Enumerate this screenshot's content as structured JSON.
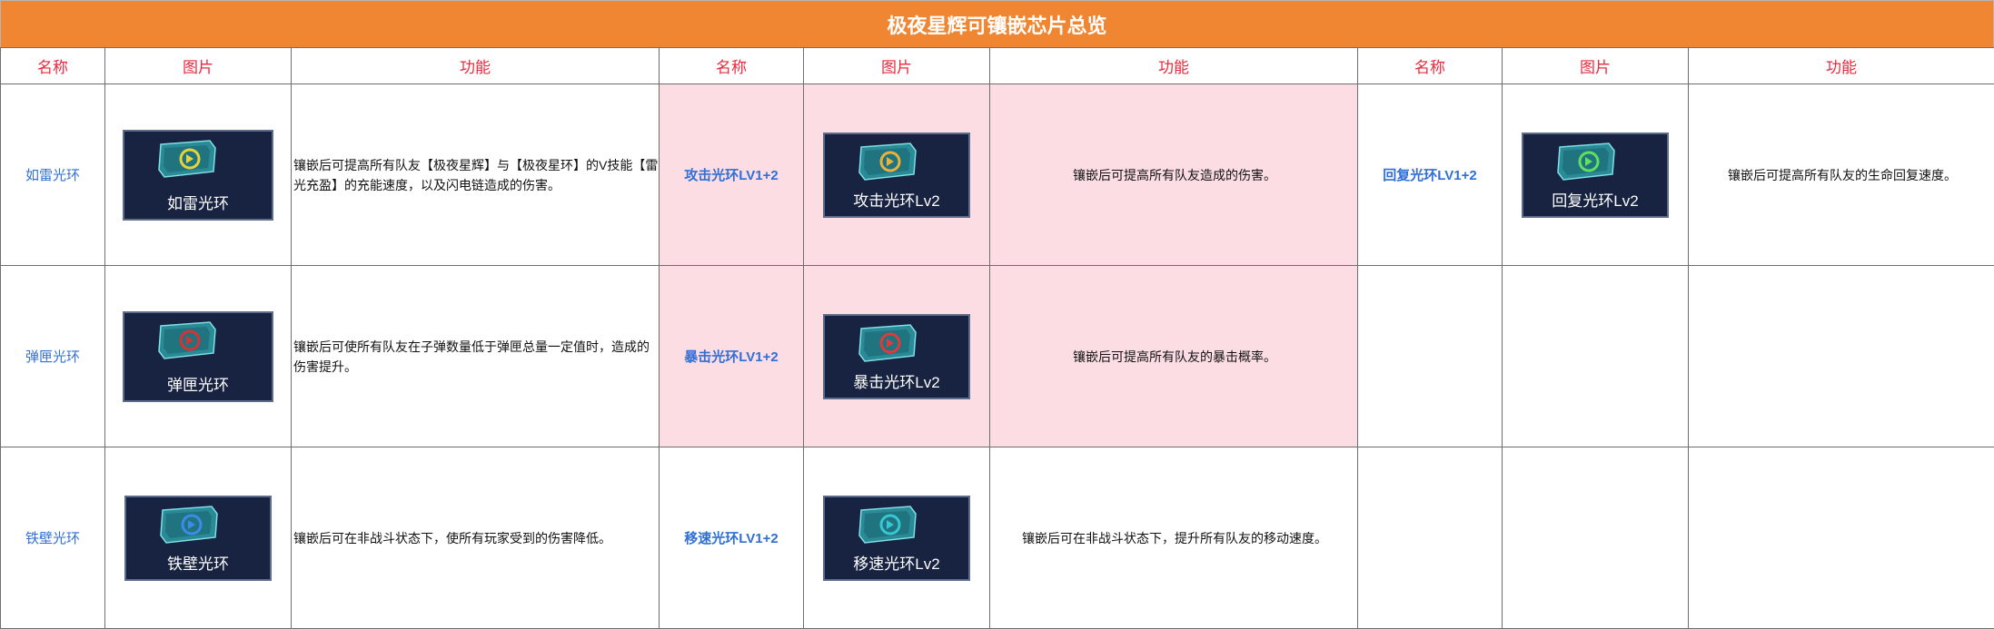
{
  "title": "极夜星辉可镶嵌芯片总览",
  "headers": [
    "名称",
    "图片",
    "功能",
    "名称",
    "图片",
    "功能",
    "名称",
    "图片",
    "功能"
  ],
  "colors": {
    "title_bg": "#f08632",
    "header_text": "#e8293d",
    "name_text": "#2f6fd6",
    "highlight_bg": "#fbdde3",
    "chip_bg": "#172341"
  },
  "rows": [
    [
      {
        "name": "如雷光环",
        "image_label": "如雷光环",
        "icon": "lightning-chip-icon",
        "icon_color": "#e8d23c",
        "function": "镶嵌后可提高所有队友【极夜星辉】与【极夜星环】的V技能【雷光充盈】的充能速度，以及闪电链造成的伤害。"
      },
      {
        "name": "攻击光环LV1+2",
        "image_label": "攻击光环Lv2",
        "icon": "attack-chip-icon",
        "icon_color": "#e8b23c",
        "function": "镶嵌后可提高所有队友造成的伤害。"
      },
      {
        "name": "回复光环LV1+2",
        "image_label": "回复光环Lv2",
        "icon": "heal-chip-icon",
        "icon_color": "#5fe05f",
        "function": "镶嵌后可提高所有队友的生命回复速度。"
      }
    ],
    [
      {
        "name": "弹匣光环",
        "image_label": "弹匣光环",
        "icon": "magazine-chip-icon",
        "icon_color": "#d83232",
        "function": "镶嵌后可使所有队友在子弹数量低于弹匣总量一定值时，造成的伤害提升。"
      },
      {
        "name": "暴击光环LV1+2",
        "image_label": "暴击光环Lv2",
        "icon": "critical-chip-icon",
        "icon_color": "#e03a3a",
        "function": "镶嵌后可提高所有队友的暴击概率。"
      },
      null
    ],
    [
      {
        "name": "铁壁光环",
        "image_label": "铁壁光环",
        "icon": "shield-chip-icon",
        "icon_color": "#3c8be8",
        "function": "镶嵌后可在非战斗状态下，使所有玩家受到的伤害降低。"
      },
      {
        "name": "移速光环LV1+2",
        "image_label": "移速光环Lv2",
        "icon": "speed-chip-icon",
        "icon_color": "#37c6d4",
        "function": "镶嵌后可在非战斗状态下，提升所有队友的移动速度。"
      },
      null
    ]
  ]
}
